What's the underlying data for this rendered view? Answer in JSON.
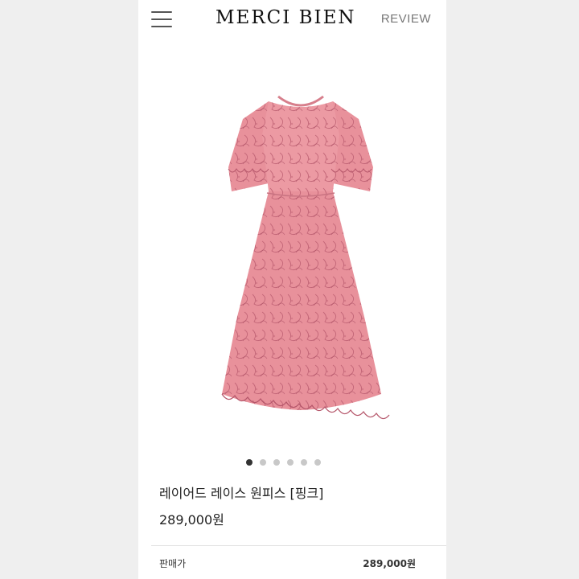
{
  "header": {
    "logo": "MERCI BIEN",
    "review_label": "REVIEW"
  },
  "product": {
    "name": "레이어드 레이스 원피스 [핑크]",
    "price": "289,000원",
    "image_alt": "pink lace dress",
    "dress_color": "#e8919b",
    "lace_color": "#b5566a"
  },
  "carousel": {
    "total": 6,
    "active_index": 0
  },
  "pricing": {
    "sale_label": "판매가",
    "sale_value": "289,000원"
  },
  "icons": {
    "menu": "hamburger-menu-icon"
  }
}
